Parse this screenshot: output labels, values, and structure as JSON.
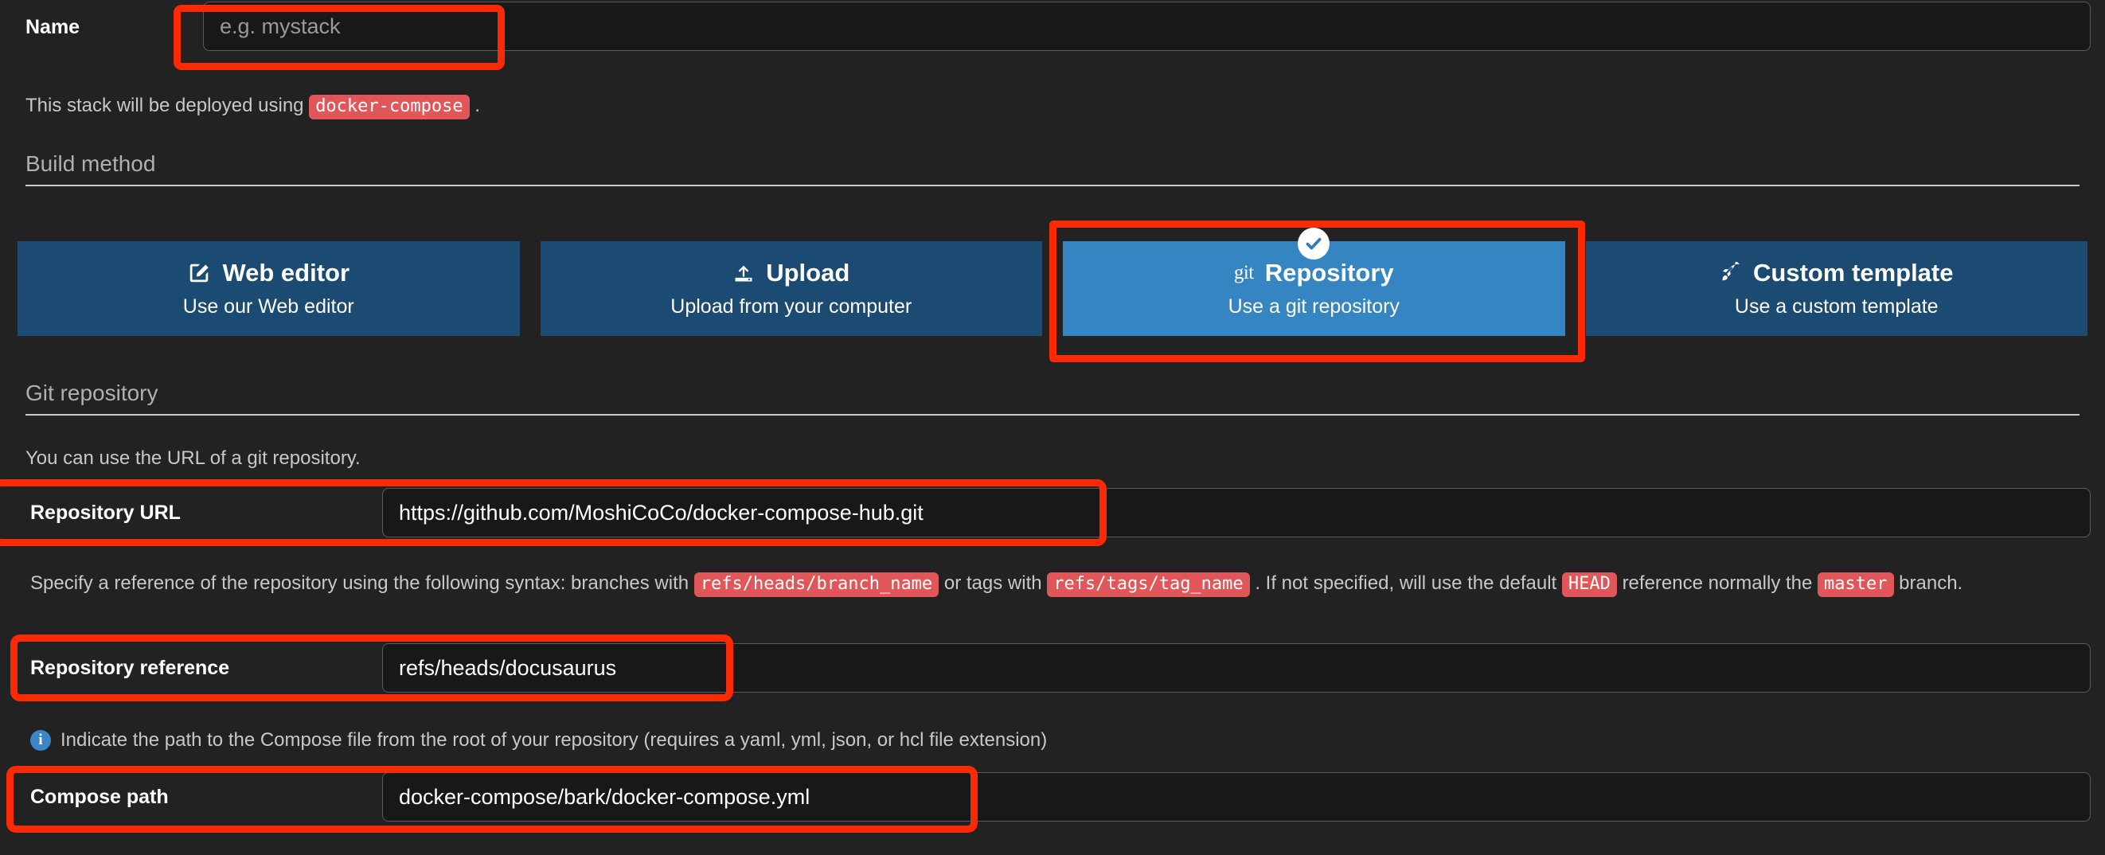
{
  "form": {
    "name": {
      "label": "Name",
      "value": "",
      "placeholder": "e.g. mystack"
    },
    "deploy_note": {
      "prefix": "This stack will be deployed using",
      "code": "docker-compose",
      "suffix": "."
    }
  },
  "build_method": {
    "section_title": "Build method",
    "tiles": [
      {
        "title": "Web editor",
        "subtitle": "Use our Web editor",
        "icon": "pencil-square-icon",
        "selected": false
      },
      {
        "title": "Upload",
        "subtitle": "Upload from your computer",
        "icon": "upload-icon",
        "selected": false
      },
      {
        "title": "Repository",
        "subtitle": "Use a git repository",
        "icon": "git-text-icon",
        "icon_text": "git",
        "selected": true
      },
      {
        "title": "Custom template",
        "subtitle": "Use a custom template",
        "icon": "rocket-icon",
        "selected": false
      }
    ]
  },
  "git_repository": {
    "section_title": "Git repository",
    "note": "You can use the URL of a git repository.",
    "url": {
      "label": "Repository URL",
      "value": "https://github.com/MoshiCoCo/docker-compose-hub.git"
    },
    "reference_help": {
      "part1": "Specify a reference of the repository using the following syntax: branches with",
      "code1": "refs/heads/branch_name",
      "part2": "or tags with",
      "code2": "refs/tags/tag_name",
      "part3": ". If not specified, will use the default",
      "code3": "HEAD",
      "part4": "reference normally the",
      "code4": "master",
      "part5": "branch."
    },
    "reference": {
      "label": "Repository reference",
      "value": "refs/heads/docusaurus"
    },
    "compose_help": {
      "icon": "info-circle-icon",
      "text": "Indicate the path to the Compose file from the root of your repository (requires a yaml, yml, json, or hcl file extension)"
    },
    "compose_path": {
      "label": "Compose path",
      "value": "docker-compose/bark/docker-compose.yml"
    }
  },
  "colors": {
    "background": "#222222",
    "input_background": "#181818",
    "tile_unselected": "#1b4a72",
    "tile_selected": "#3585c3",
    "code_badge": "#e15759",
    "annotation": "#fa2a05",
    "info_icon": "#3a86c8"
  }
}
